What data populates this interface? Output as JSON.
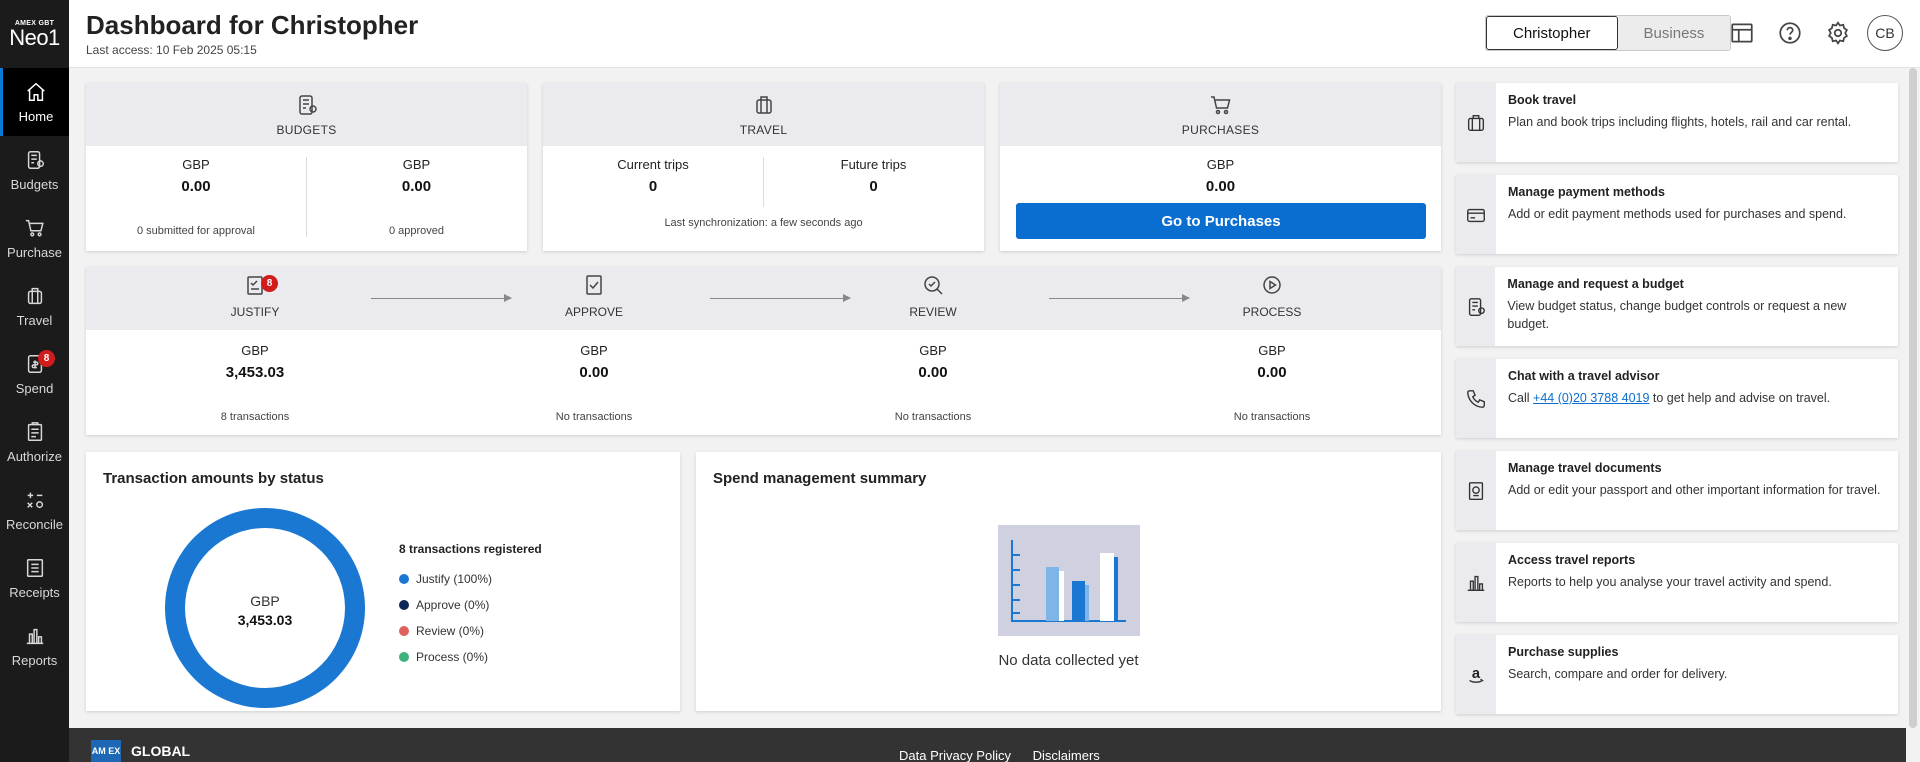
{
  "logo": {
    "small": "AMEX GBT",
    "big": "Neo1"
  },
  "sidebar": {
    "items": [
      {
        "label": "Home",
        "icon": "home-icon"
      },
      {
        "label": "Budgets",
        "icon": "budgets-icon"
      },
      {
        "label": "Purchase",
        "icon": "cart-icon"
      },
      {
        "label": "Travel",
        "icon": "suitcase-icon"
      },
      {
        "label": "Spend",
        "icon": "spend-icon",
        "badge": "8"
      },
      {
        "label": "Authorize",
        "icon": "clipboard-icon"
      },
      {
        "label": "Reconcile",
        "icon": "calculator-icon"
      },
      {
        "label": "Receipts",
        "icon": "receipt-icon"
      },
      {
        "label": "Reports",
        "icon": "bar-chart-icon"
      }
    ]
  },
  "header": {
    "title": "Dashboard for Christopher",
    "last_access": "Last access: 10 Feb 2025 05:15",
    "toggle": {
      "personal": "Christopher",
      "business": "Business"
    },
    "avatar": "CB"
  },
  "budgets": {
    "title": "BUDGETS",
    "left": {
      "currency": "GBP",
      "amount": "0.00",
      "sub": "0 submitted for approval"
    },
    "right": {
      "currency": "GBP",
      "amount": "0.00",
      "sub": "0 approved"
    }
  },
  "travel": {
    "title": "TRAVEL",
    "left": {
      "label": "Current trips",
      "value": "0"
    },
    "right": {
      "label": "Future trips",
      "value": "0"
    },
    "sync": "Last synchronization: a few seconds ago"
  },
  "purchases": {
    "title": "PURCHASES",
    "currency": "GBP",
    "amount": "0.00",
    "button": "Go to Purchases"
  },
  "workflow": {
    "steps": [
      {
        "title": "JUSTIFY",
        "currency": "GBP",
        "amount": "3,453.03",
        "sub": "8 transactions",
        "badge": "8"
      },
      {
        "title": "APPROVE",
        "currency": "GBP",
        "amount": "0.00",
        "sub": "No transactions"
      },
      {
        "title": "REVIEW",
        "currency": "GBP",
        "amount": "0.00",
        "sub": "No transactions"
      },
      {
        "title": "PROCESS",
        "currency": "GBP",
        "amount": "0.00",
        "sub": "No transactions"
      }
    ]
  },
  "status_panel": {
    "title": "Transaction amounts by status",
    "donut_currency": "GBP",
    "donut_amount": "3,453.03",
    "legend_head": "8 transactions registered",
    "legend": [
      {
        "label": "Justify (100%)",
        "color": "#1a78d2",
        "share": 1.0
      },
      {
        "label": "Approve (0%)",
        "color": "#0d2456",
        "share": 0
      },
      {
        "label": "Review (0%)",
        "color": "#e06060",
        "share": 0
      },
      {
        "label": "Process (0%)",
        "color": "#3cb37e",
        "share": 0
      }
    ]
  },
  "spend_panel": {
    "title": "Spend management summary",
    "empty": "No data collected yet"
  },
  "quick_links": [
    {
      "title": "Book travel",
      "desc": "Plan and book trips including flights, hotels, rail and car rental.",
      "icon": "suitcase-icon"
    },
    {
      "title": "Manage payment methods",
      "desc": "Add or edit payment methods used for purchases and spend.",
      "icon": "card-icon"
    },
    {
      "title": "Manage and request a budget",
      "desc": "View budget status, change budget controls or request a new budget.",
      "icon": "budgets-icon"
    },
    {
      "title": "Chat with a travel advisor",
      "desc_pre": "Call ",
      "phone": "+44 (0)20 3788 4019",
      "desc_post": " to get help and advise on travel.",
      "icon": "phone-icon"
    },
    {
      "title": "Manage travel documents",
      "desc": "Add or edit your passport and other important information for travel.",
      "icon": "passport-icon"
    },
    {
      "title": "Access travel reports",
      "desc": "Reports to help you analyse your travel activity and spend.",
      "icon": "bar-chart-icon"
    },
    {
      "title": "Purchase supplies",
      "desc": "Search, compare and order for delivery.",
      "icon": "amazon-icon"
    }
  ],
  "footer": {
    "brand_box": "AM EX",
    "brand": "GLOBAL",
    "links": [
      "Data Privacy Policy",
      "Disclaimers"
    ]
  }
}
